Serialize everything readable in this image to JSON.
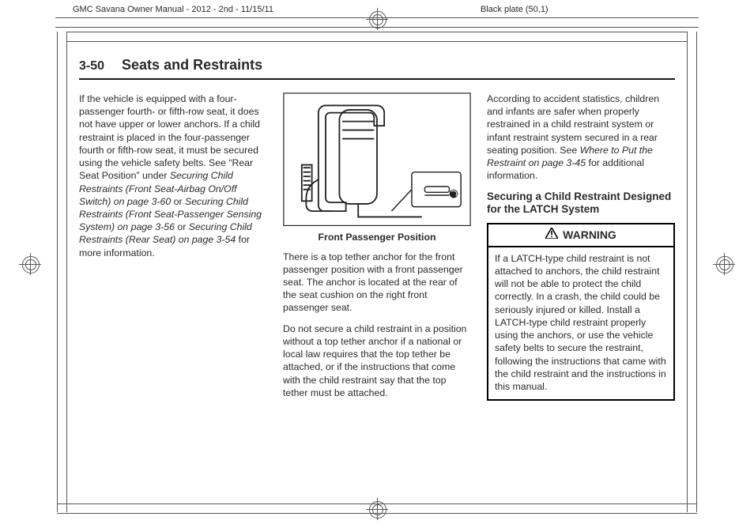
{
  "crop": {
    "top_left_label": "GMC Savana Owner Manual - 2012 - 2nd - 11/15/11",
    "top_right_label": "Black plate (50,1)"
  },
  "running_head": {
    "page_number": "3-50",
    "section_title": "Seats and Restraints"
  },
  "col1": {
    "p1_a": "If the vehicle is equipped with a four-passenger fourth- or fifth-row seat, it does not have upper or lower anchors. If a child restraint is placed in the four-passenger fourth or fifth-row seat, it must be secured using the vehicle safety belts. See “Rear Seat Position” under ",
    "p1_link1": "Securing Child Restraints (Front Seat‑Airbag On/Off Switch) on page 3‑60",
    "p1_b": " or ",
    "p1_link2": "Securing Child Restraints (Front Seat‑Passenger Sensing System) on page 3‑56",
    "p1_c": " or ",
    "p1_link3": "Securing Child Restraints (Rear Seat) on page 3‑54",
    "p1_d": " for more information."
  },
  "col2": {
    "fig_caption": "Front Passenger Position",
    "p1": "There is a top tether anchor for the front passenger position with a front passenger seat. The anchor is located at the rear of the seat cushion on the right front passenger seat.",
    "p2": "Do not secure a child restraint in a position without a top tether anchor if a national or local law requires that the top tether be attached, or if the instructions that come with the child restraint say that the top tether must be attached."
  },
  "col3": {
    "p1_a": "According to accident statistics, children and infants are safer when properly restrained in a child restraint system or infant restraint system secured in a rear seating position. See ",
    "p1_link": "Where to Put the Restraint on page 3‑45",
    "p1_b": " for additional information.",
    "subheading": "Securing a Child Restraint Designed for the LATCH System",
    "warning_label": "WARNING",
    "warning_body": "If a LATCH-type child restraint is not attached to anchors, the child restraint will not be able to protect the child correctly. In a crash, the child could be seriously injured or killed. Install a LATCH-type child restraint properly using the anchors, or use the vehicle safety belts to secure the restraint, following the instructions that came with the child restraint and the instructions in this manual."
  }
}
